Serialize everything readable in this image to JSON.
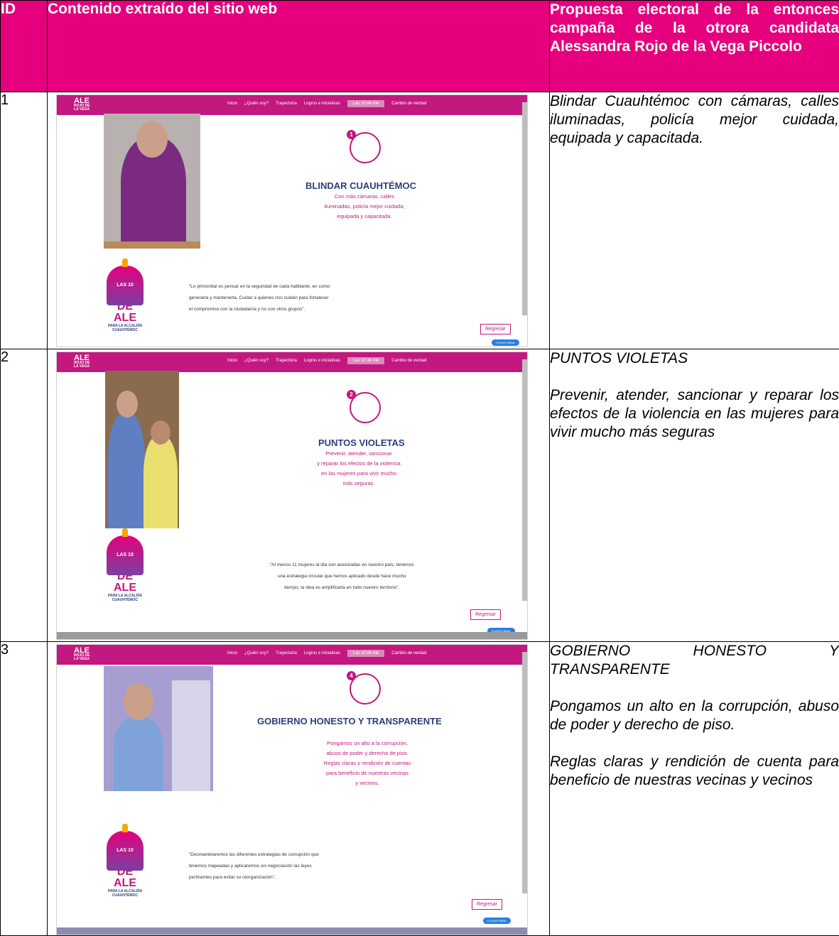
{
  "header": {
    "id": "ID",
    "content": "Contenido extraído del sitio web",
    "proposal": "Propuesta electoral de la entonces campaña de la otrora candidata Alessandra Rojo de la Vega Piccolo"
  },
  "site": {
    "logo_main": "ALE",
    "logo_sub": "ROJO DE LA VEGA",
    "nav": [
      "Inicio",
      "¿Quién soy?",
      "Trayectoria",
      "Logros e iniciativas",
      "Las 10 de Ale",
      "Cambio de verdad"
    ],
    "las10_line1": "LAS 10",
    "las10_line2": "DE ALE",
    "las10_line3": "PARA LA ALCALDÍA",
    "las10_line4": "CUAUHTÉMOC",
    "back_button": "Regresar",
    "pill": "PLATAFORMA"
  },
  "rows": [
    {
      "id": "1",
      "badge": "1",
      "site_title": "BLINDAR CUAUHTÉMOC",
      "site_desc": [
        "Con más cámaras, calles",
        "iluminadas, policía mejor cuidada,",
        "equipada y capacitada."
      ],
      "quote": [
        "“Lo primordial es pensar en la seguridad de cada habitante, en como",
        "generarla y mantenerla. Cuidar a quienes nos cuidan para fortalecer",
        "el compromiso con la ciudadanía y no con otros grupos”."
      ],
      "proposal": [
        "Blindar Cuauhtémoc con cámaras, calles iluminadas, policía mejor cuidada, equipada y capacitada."
      ]
    },
    {
      "id": "2",
      "badge": "2",
      "site_title": "PUNTOS VIOLETAS",
      "site_desc": [
        "Prevenir, atender, sancionar",
        "y reparar los efectos de la violencia",
        "en las mujeres para vivir mucho",
        "más seguras."
      ],
      "quote": [
        "“Al menos 11 mujeres al día son asesinadas en nuestro país, tenemos",
        "una estrategia circular que hemos aplicado desde hace mucho",
        "tiempo, la idea es amplificarla en todo nuestro territorio”."
      ],
      "proposal": [
        "PUNTOS VIOLETAS",
        "Prevenir, atender, sancionar y reparar los efectos de la violencia en las mujeres para vivir mucho más seguras"
      ]
    },
    {
      "id": "3",
      "badge": "4",
      "site_title": "GOBIERNO HONESTO Y TRANSPARENTE",
      "site_desc": [
        "Pongamos un alto a la corrupción,",
        "abuso de poder y derecho de piso.",
        "Reglas claras y rendición de cuentas",
        "para beneficio de nuestras vecinas",
        "y vecinos."
      ],
      "quote": [
        "“Desmantelaremos las diferentes estrategias de corrupción que",
        "tenemos mapeadas y aplicaremos sin negociación las leyes",
        "pertinentes para evitar su reorganización”."
      ],
      "proposal": [
        "GOBIERNO HONESTO Y TRANSPARENTE",
        "Pongamos un alto en la corrupción, abuso de poder y derecho de piso.",
        "Reglas claras y rendición de cuenta para beneficio de nuestras vecinas y vecinos"
      ]
    }
  ],
  "colors": {
    "brand": "#c2187f",
    "header_bg": "#e6007e",
    "title_blue": "#2d3f7a"
  }
}
